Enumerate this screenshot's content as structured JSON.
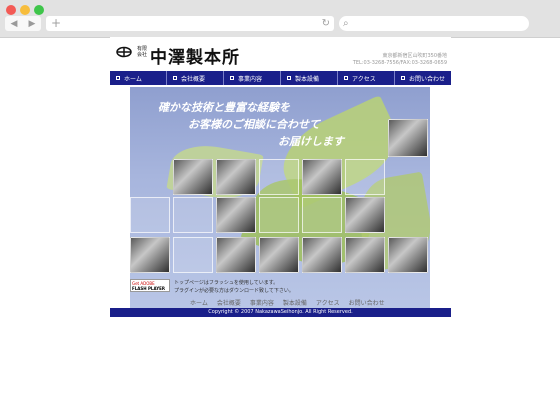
{
  "browser": {
    "back_glyph": "◀",
    "forward_glyph": "▶",
    "new_tab_glyph": "+",
    "reload_glyph": "↻",
    "search_glyph": "⌕"
  },
  "site": {
    "logo_small": "有限会社",
    "logo_text": "中澤製本所",
    "address_line1": "東京都新宿区山吹町350番地",
    "address_line2": "TEL:03-3268-7556/FAX:03-3268-0659",
    "menu": [
      {
        "label": "ホーム"
      },
      {
        "label": "会社概要"
      },
      {
        "label": "事業内容"
      },
      {
        "label": "製本設備"
      },
      {
        "label": "アクセス"
      },
      {
        "label": "お問い合わせ"
      }
    ],
    "hero": {
      "line1": "確かな技術と豊富な経験を",
      "line2": "お客様のご相談に合わせて",
      "line3": "お届けします"
    },
    "flash_badge_top": "Get ADOBE",
    "flash_badge_bottom": "FLASH PLAYER",
    "flash_note_line1": "トップページはフラッシュを使用しています。",
    "flash_note_line2": "プラグインが必要な方はダウンロード致して下さい。",
    "footer_nav": [
      "ホーム",
      "会社概要",
      "事業内容",
      "製本設備",
      "アクセス",
      "お問い合わせ"
    ],
    "copyright": "Copyright © 2007 NakazawaSeihonjo. All Right Reserved."
  },
  "colors": {
    "nav_bg": "#1a1f8a",
    "hero_bg": "#9aa8d6"
  }
}
